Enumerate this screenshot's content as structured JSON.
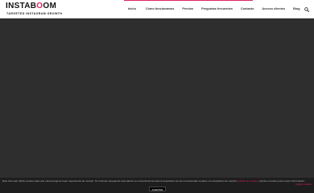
{
  "header": {
    "logo_text_1": "INSTAB",
    "logo_text_2": "O",
    "logo_text_3": "OM",
    "tagline": "TARGETED INSTAGRAM GROWTH"
  },
  "nav": {
    "items": [
      {
        "label": "Inicio"
      },
      {
        "label": "Cómo funcionamos"
      },
      {
        "label": "Precios"
      },
      {
        "label": "Preguntas frecuentes"
      },
      {
        "label": "Contacto"
      },
      {
        "label": "Acceso clientes"
      },
      {
        "label": "Blog"
      }
    ],
    "search_icon": "search-icon"
  },
  "cookie": {
    "text": "Este sitio web utiliza cookies para que usted tenga la mejor experiencia de usuario. Si continúa navegando está dando su consentimiento para la aceptación de las mencionadas cookies y la aceptación de nuestra",
    "policy_link": "política",
    "text_2": "de cookies",
    "text_3": ", pinche el enlace para mayor información.",
    "more_link": "plugin cookies",
    "accept_label": "ACEPTAR"
  },
  "colors": {
    "accent": "#e0245e",
    "background": "#2e2e2e",
    "header_bg": "#ffffff",
    "cookie_bg": "#1e1e1e"
  }
}
